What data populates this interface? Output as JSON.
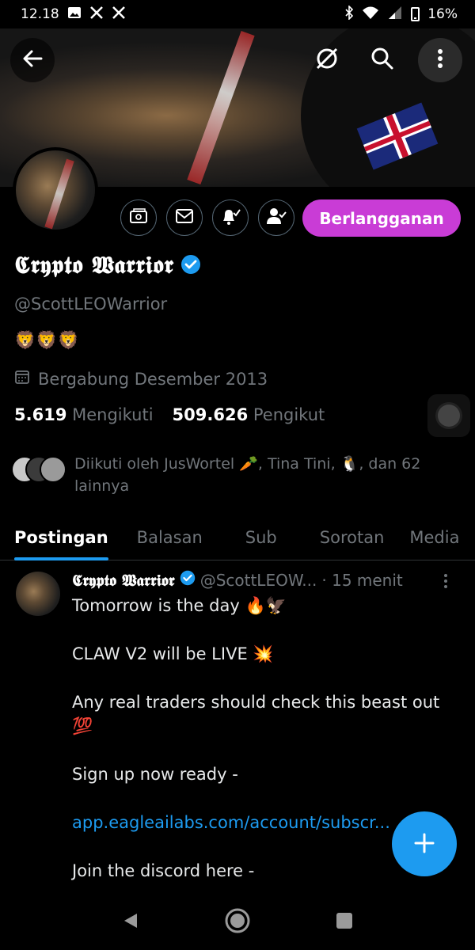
{
  "status_bar": {
    "time": "12.18",
    "battery": "16%",
    "left_icons": [
      "image-icon",
      "x-logo-icon",
      "x-logo-icon"
    ],
    "right_icons": [
      "bluetooth-icon",
      "wifi-icon",
      "signal-icon",
      "battery-icon"
    ]
  },
  "header": {
    "back_icon": "arrow-left-icon",
    "grok_icon": "grok-icon",
    "search_icon": "search-icon",
    "more_icon": "more-vertical-icon"
  },
  "profile": {
    "display_name": "𝕮𝖗𝖞𝖕𝖙𝖔 𝖂𝖆𝖗𝖗𝖎𝖔𝖗",
    "handle": "@ScottLEOWarrior",
    "bio": "🦁🦁🦁",
    "joined": "Bergabung Desember 2013",
    "following_count": "5.619",
    "following_label": "Mengikuti",
    "followers_count": "509.626",
    "followers_label": "Pengikut",
    "followed_by": "Diikuti oleh JusWortel 🥕, Tina Tini, 🐧, dan 62 lainnya",
    "subscribe_label": "Berlangganan",
    "verified_color": "#1d9bf0",
    "accent_color": "#c93cd6"
  },
  "tabs": [
    {
      "label": "Postingan",
      "active": true
    },
    {
      "label": "Balasan",
      "active": false
    },
    {
      "label": "Sub",
      "active": false
    },
    {
      "label": "Sorotan",
      "active": false
    },
    {
      "label": "Media",
      "active": false
    }
  ],
  "post": {
    "author": "𝕮𝖗𝖞𝖕𝖙𝖔 𝖂𝖆𝖗𝖗𝖎𝖔𝖗",
    "handle": "@ScottLEOW...",
    "time": "· 15 menit",
    "lines": [
      "Tomorrow is the day 🔥🦅",
      "CLAW V2 will be LIVE 💥",
      "Any real traders should check this beast out 💯",
      "Sign up now ready -",
      "app.eagleailabs.com/account/subscr...",
      "Join the discord here -"
    ]
  },
  "fab": {
    "icon": "plus-icon"
  },
  "nav": {
    "back": "back-triangle-icon",
    "home": "home-circle-icon",
    "recents": "recents-square-icon"
  }
}
